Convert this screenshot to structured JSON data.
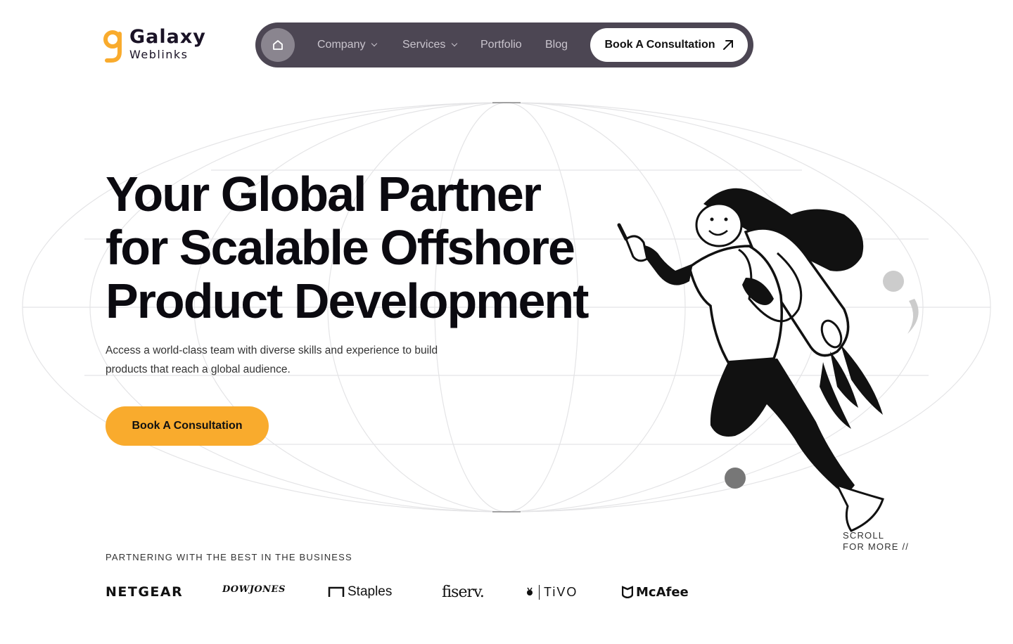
{
  "brand": {
    "name": "Galaxy",
    "tagline": "Weblinks",
    "accent_color": "#f9ab2d",
    "nav_bg": "#4c4653"
  },
  "nav": {
    "home_icon": "home-icon",
    "items": [
      {
        "label": "Company",
        "has_dropdown": true
      },
      {
        "label": "Services",
        "has_dropdown": true
      },
      {
        "label": "Portfolio",
        "has_dropdown": false
      },
      {
        "label": "Blog",
        "has_dropdown": false
      }
    ],
    "cta_label": "Book A Consultation",
    "cta_icon": "arrow-up-right-icon"
  },
  "hero": {
    "title_lines": [
      "Your Global Partner",
      "for Scalable Offshore",
      "Product Development"
    ],
    "description": "Access a world-class team with diverse skills and experience to build products that reach a global audience.",
    "cta_label": "Book A Consultation"
  },
  "scroll_hint": {
    "line1": "SCROLL",
    "line2": "FOR MORE //"
  },
  "partners": {
    "label": "PARTNERING WITH THE BEST IN THE BUSINESS",
    "logos": [
      "NETGEAR",
      "DOWJONES",
      "Staples",
      "fiserv.",
      "TiVO",
      "McAfee"
    ]
  }
}
